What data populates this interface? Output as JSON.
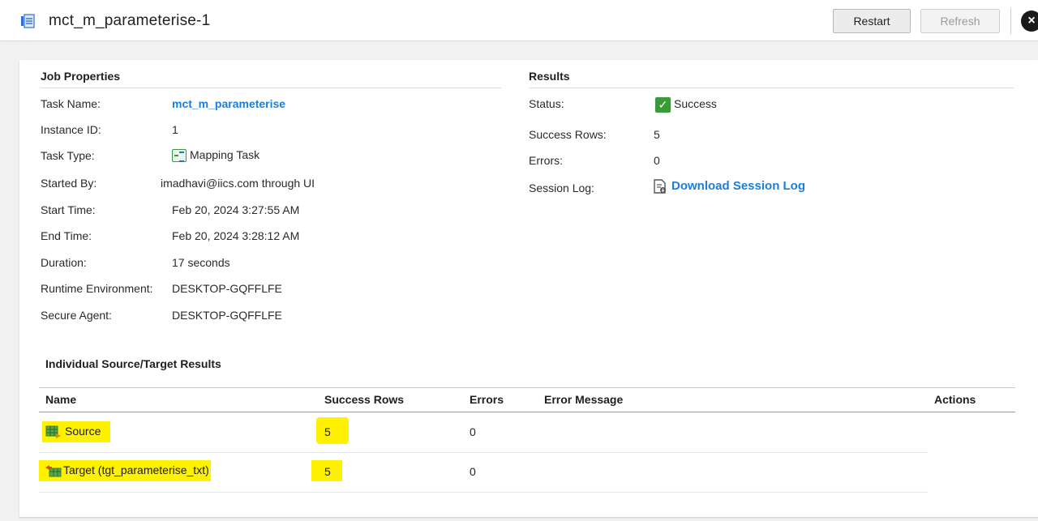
{
  "header": {
    "title": "mct_m_parameterise-1",
    "restart_label": "Restart",
    "refresh_label": "Refresh",
    "close_icon": "×"
  },
  "job_properties": {
    "heading": "Job Properties",
    "task_name_label": "Task Name:",
    "task_name": "mct_m_parameterise",
    "instance_id_label": "Instance ID:",
    "instance_id": "1",
    "task_type_label": "Task Type:",
    "task_type": "Mapping Task",
    "started_by_label": "Started By:",
    "started_by": "imadhavi@iics.com through UI",
    "start_time_label": "Start Time:",
    "start_time": "Feb 20, 2024 3:27:55 AM",
    "end_time_label": "End Time:",
    "end_time": "Feb 20, 2024 3:28:12 AM",
    "duration_label": "Duration:",
    "duration": "17 seconds",
    "runtime_env_label": "Runtime Environment:",
    "runtime_env": "DESKTOP-GQFFLFE",
    "secure_agent_label": "Secure Agent:",
    "secure_agent": "DESKTOP-GQFFLFE"
  },
  "results": {
    "heading": "Results",
    "status_label": "Status:",
    "status": "Success",
    "success_rows_label": "Success Rows:",
    "success_rows": "5",
    "errors_label": "Errors:",
    "errors": "0",
    "session_log_label": "Session Log:",
    "session_log_link": "Download Session Log"
  },
  "individual": {
    "heading": "Individual Source/Target Results",
    "columns": [
      "Name",
      "Success Rows",
      "Errors",
      "Error Message",
      "Actions"
    ],
    "rows": [
      {
        "name": "Source",
        "success_rows": "5",
        "errors": "0",
        "error_message": ""
      },
      {
        "name": "Target (tgt_parameterise_txt)",
        "success_rows": "5",
        "errors": "0",
        "error_message": ""
      }
    ]
  },
  "colors": {
    "link": "#1a7fd9",
    "success": "#3a9a3a",
    "highlight": "#fff200"
  }
}
